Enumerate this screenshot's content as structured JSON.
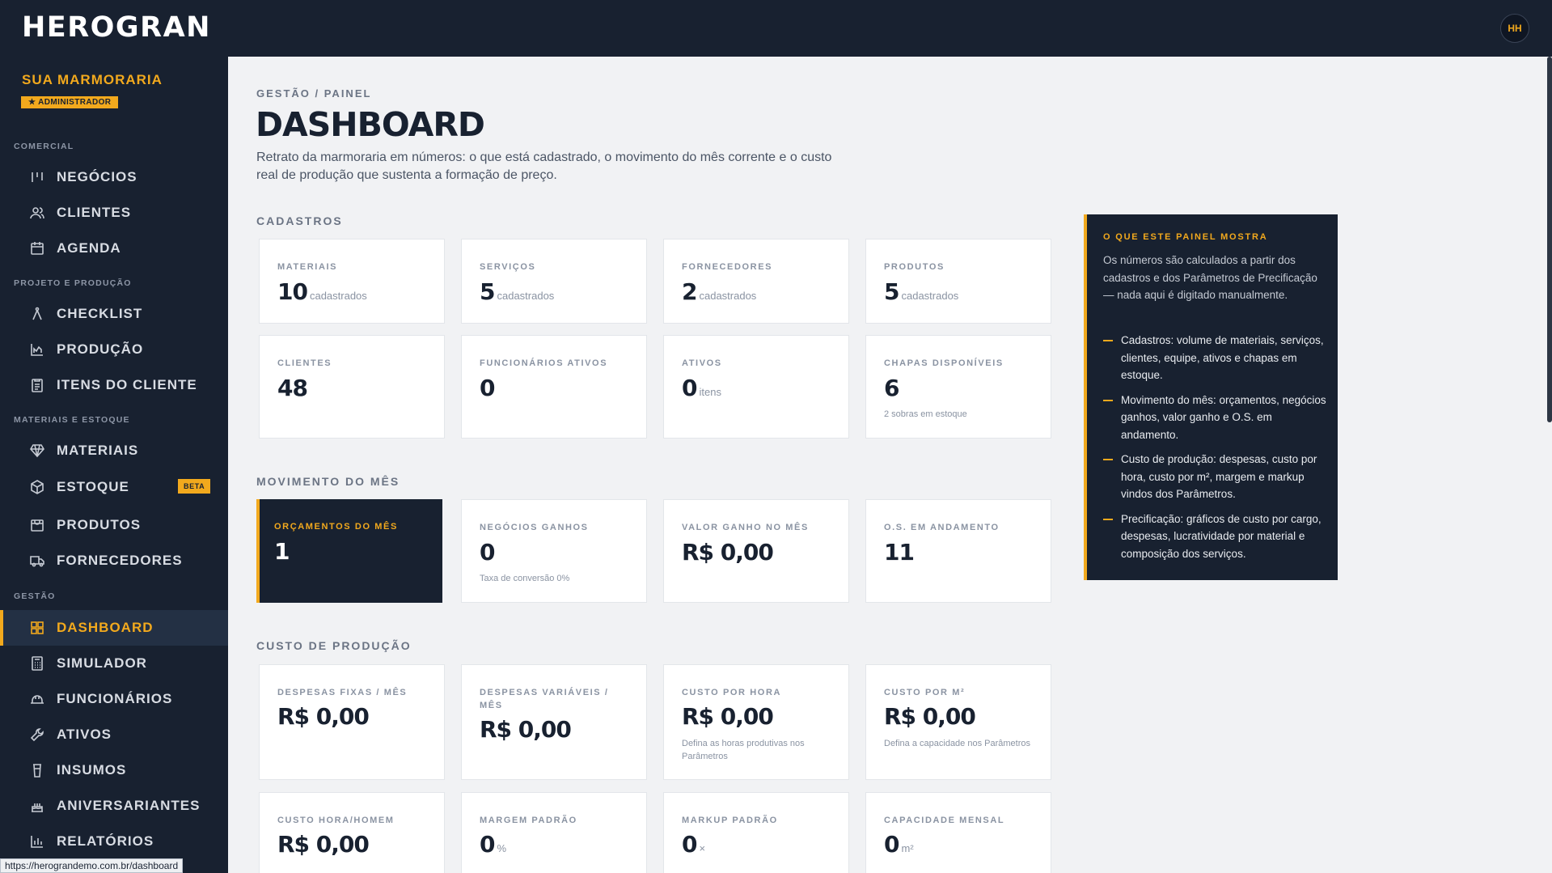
{
  "app": {
    "brand": "HEROGRAN",
    "avatar_initials": "HH",
    "status_url": "https://herograndemo.com.br/dashboard"
  },
  "sidebar": {
    "company": "SUA MARMORARIA",
    "role": "★ ADMINISTRADOR",
    "sections": [
      {
        "title": "COMERCIAL"
      },
      {
        "title": "PROJETO E PRODUÇÃO"
      },
      {
        "title": "MATERIAIS E ESTOQUE"
      },
      {
        "title": "GESTÃO"
      }
    ],
    "items": [
      {
        "label": "NEGÓCIOS",
        "icon": "kanban-icon"
      },
      {
        "label": "CLIENTES",
        "icon": "users-icon"
      },
      {
        "label": "AGENDA",
        "icon": "calendar-icon"
      },
      {
        "label": "CHECKLIST",
        "icon": "compass-icon"
      },
      {
        "label": "PRODUÇÃO",
        "icon": "factory-chart-icon"
      },
      {
        "label": "ITENS DO CLIENTE",
        "icon": "clipboard-icon"
      },
      {
        "label": "MATERIAIS",
        "icon": "diamond-icon"
      },
      {
        "label": "ESTOQUE",
        "icon": "box-icon",
        "badge": "BETA"
      },
      {
        "label": "PRODUTOS",
        "icon": "package-icon"
      },
      {
        "label": "FORNECEDORES",
        "icon": "truck-icon"
      },
      {
        "label": "DASHBOARD",
        "icon": "grid-icon",
        "active": true
      },
      {
        "label": "SIMULADOR",
        "icon": "calculator-icon"
      },
      {
        "label": "FUNCIONÁRIOS",
        "icon": "hardhat-icon"
      },
      {
        "label": "ATIVOS",
        "icon": "wrench-icon"
      },
      {
        "label": "INSUMOS",
        "icon": "cup-icon"
      },
      {
        "label": "ANIVERSARIANTES",
        "icon": "cake-icon"
      },
      {
        "label": "RELATÓRIOS",
        "icon": "bar-chart-icon"
      }
    ]
  },
  "main": {
    "breadcrumb": "GESTÃO / PAINEL",
    "title": "DASHBOARD",
    "lead": "Retrato da marmoraria em números: o que está cadastrado, o movimento do mês corrente e o custo real de produção que sustenta a formação de preço.",
    "groups": {
      "cadastros": "CADASTROS",
      "movimento": "MOVIMENTO DO MÊS",
      "custo": "CUSTO DE PRODUÇÃO"
    },
    "cadastros": [
      {
        "label": "MATERIAIS",
        "value": "10",
        "unit": "cadastrados"
      },
      {
        "label": "SERVIÇOS",
        "value": "5",
        "unit": "cadastrados"
      },
      {
        "label": "FORNECEDORES",
        "value": "2",
        "unit": "cadastrados"
      },
      {
        "label": "PRODUTOS",
        "value": "5",
        "unit": "cadastrados"
      },
      {
        "label": "CLIENTES",
        "value": "48",
        "unit": ""
      },
      {
        "label": "FUNCIONÁRIOS ATIVOS",
        "value": "0",
        "unit": ""
      },
      {
        "label": "ATIVOS",
        "value": "0",
        "unit": "itens"
      },
      {
        "label": "CHAPAS DISPONÍVEIS",
        "value": "6",
        "unit": "",
        "note": "2 sobras em estoque"
      }
    ],
    "movimento": [
      {
        "label": "ORÇAMENTOS DO MÊS",
        "value": "1",
        "dark": true
      },
      {
        "label": "NEGÓCIOS GANHOS",
        "value": "0",
        "note": "Taxa de conversão 0%"
      },
      {
        "label": "VALOR GANHO NO MÊS",
        "value": "R$ 0,00"
      },
      {
        "label": "O.S. EM ANDAMENTO",
        "value": "11"
      }
    ],
    "custo": [
      {
        "label": "DESPESAS FIXAS / MÊS",
        "value": "R$ 0,00"
      },
      {
        "label": "DESPESAS VARIÁVEIS / MÊS",
        "value": "R$ 0,00"
      },
      {
        "label": "CUSTO POR HORA",
        "value": "R$ 0,00",
        "note": "Defina as horas produtivas nos Parâmetros"
      },
      {
        "label": "CUSTO POR M²",
        "value": "R$ 0,00",
        "note": "Defina a capacidade nos Parâmetros"
      },
      {
        "label": "CUSTO HORA/HOMEM",
        "value": "R$ 0,00"
      },
      {
        "label": "MARGEM PADRÃO",
        "value": "0",
        "unit": "%"
      },
      {
        "label": "MARKUP PADRÃO",
        "value": "0",
        "unit": "×"
      },
      {
        "label": "CAPACIDADE MENSAL",
        "value": "0",
        "unit": "m²"
      }
    ]
  },
  "info": {
    "title": "O QUE ESTE PAINEL MOSTRA",
    "intro": "Os números são calculados a partir dos cadastros e dos Parâmetros de Precificação — nada aqui é digitado manualmente.",
    "items": [
      "Cadastros: volume de materiais, serviços, clientes, equipe, ativos e chapas em estoque.",
      "Movimento do mês: orçamentos, negócios ganhos, valor ganho e O.S. em andamento.",
      "Custo de produção: despesas, custo por hora, custo por m², margem e markup vindos dos Parâmetros.",
      "Precificação: gráficos de custo por cargo, despesas, lucratividade por material e composição dos serviços."
    ]
  }
}
